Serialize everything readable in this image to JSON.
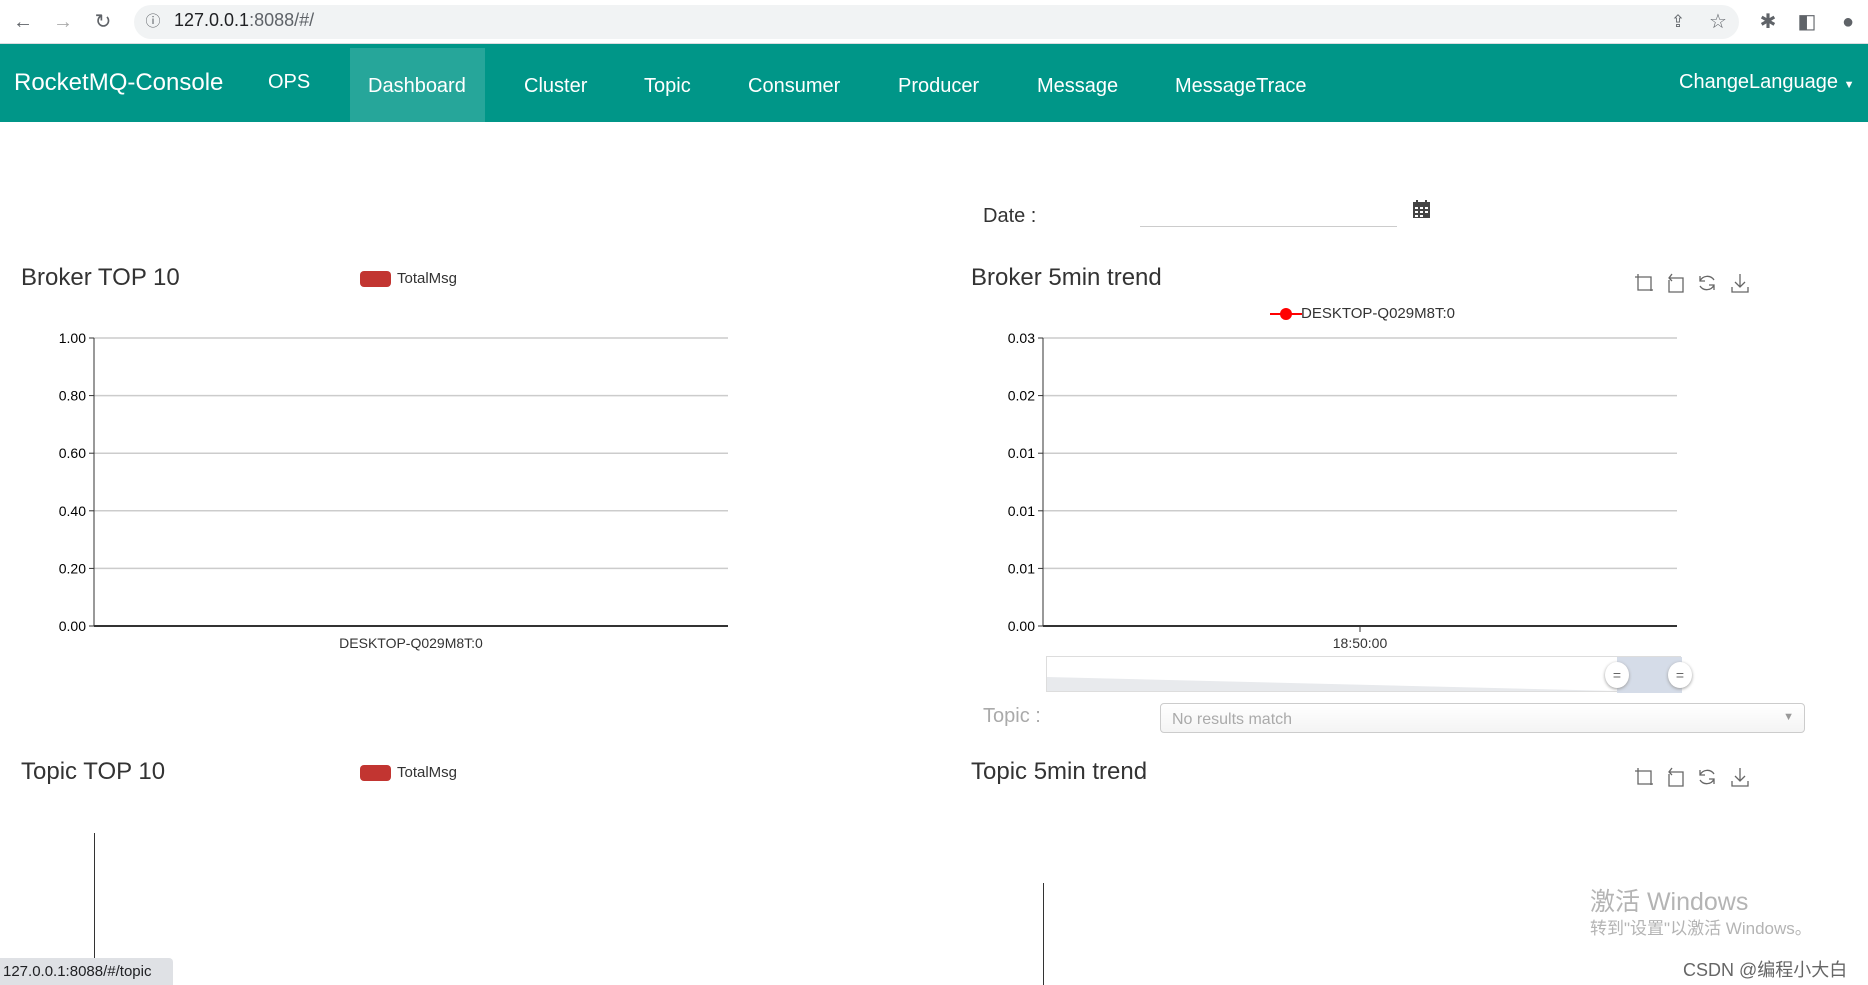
{
  "browser": {
    "url_host": "127.0.0.1",
    "url_rest": ":8088/#/",
    "status_url": "127.0.0.1:8088/#/topic"
  },
  "nav": {
    "brand": "RocketMQ-Console",
    "items": [
      {
        "label": "OPS"
      },
      {
        "label": "Dashboard",
        "active": true
      },
      {
        "label": "Cluster"
      },
      {
        "label": "Topic"
      },
      {
        "label": "Consumer"
      },
      {
        "label": "Producer"
      },
      {
        "label": "Message"
      },
      {
        "label": "MessageTrace"
      }
    ],
    "language": "ChangeLanguage",
    "color": "#009688"
  },
  "date": {
    "label": "Date :",
    "value": ""
  },
  "topic_filter": {
    "label": "Topic :",
    "placeholder": "No results match"
  },
  "charts": {
    "broker_top": {
      "title": "Broker TOP 10",
      "legend": "TotalMsg"
    },
    "broker_trend": {
      "title": "Broker 5min trend",
      "legend": "DESKTOP-Q029M8T:0"
    },
    "topic_top": {
      "title": "Topic TOP 10",
      "legend": "TotalMsg"
    },
    "topic_trend": {
      "title": "Topic 5min trend"
    }
  },
  "chart_data": [
    {
      "type": "bar",
      "title": "Broker TOP 10",
      "categories": [
        "DESKTOP-Q029M8T:0"
      ],
      "series": [
        {
          "name": "TotalMsg",
          "values": [
            0
          ],
          "color": "#c23531"
        }
      ],
      "ylim": [
        0,
        1
      ],
      "yticks": [
        "0.00",
        "0.20",
        "0.40",
        "0.60",
        "0.80",
        "1.00"
      ],
      "grid": true,
      "legend": "top"
    },
    {
      "type": "line",
      "title": "Broker 5min trend",
      "x": [
        "18:50:00"
      ],
      "series": [
        {
          "name": "DESKTOP-Q029M8T:0",
          "values": [
            0
          ],
          "color": "#ff0000"
        }
      ],
      "ylim": [
        0,
        0.03
      ],
      "yticks": [
        "0.00",
        "0.01",
        "0.01",
        "0.01",
        "0.02",
        "0.03"
      ],
      "grid": true,
      "legend": "top",
      "datazoom_range": [
        90,
        100
      ]
    }
  ],
  "watermark": {
    "line1": "激活 Windows",
    "line2": "转到\"设置\"以激活 Windows。",
    "csdn": "CSDN @编程小大白"
  }
}
